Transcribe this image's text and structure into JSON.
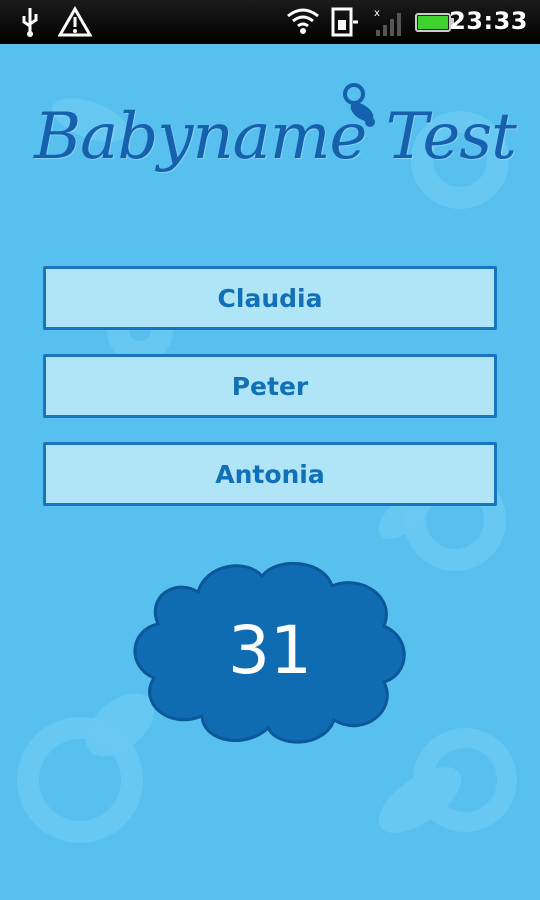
{
  "status_bar": {
    "time": "23:33",
    "icons": [
      "usb-icon",
      "warning-icon",
      "wifi-icon",
      "sim-icon",
      "signal-icon",
      "battery-icon"
    ]
  },
  "app": {
    "logo_text": "Babyname Test"
  },
  "names": [
    {
      "label": "Claudia"
    },
    {
      "label": "Peter"
    },
    {
      "label": "Antonia"
    }
  ],
  "counter": {
    "value": "31"
  },
  "colors": {
    "background": "#58c0ee",
    "button_fill": "#b0e4f7",
    "button_border": "#1774bd",
    "button_text": "#1271b6",
    "cloud_fill": "#0f6cb3",
    "logo": "#1660ad"
  }
}
